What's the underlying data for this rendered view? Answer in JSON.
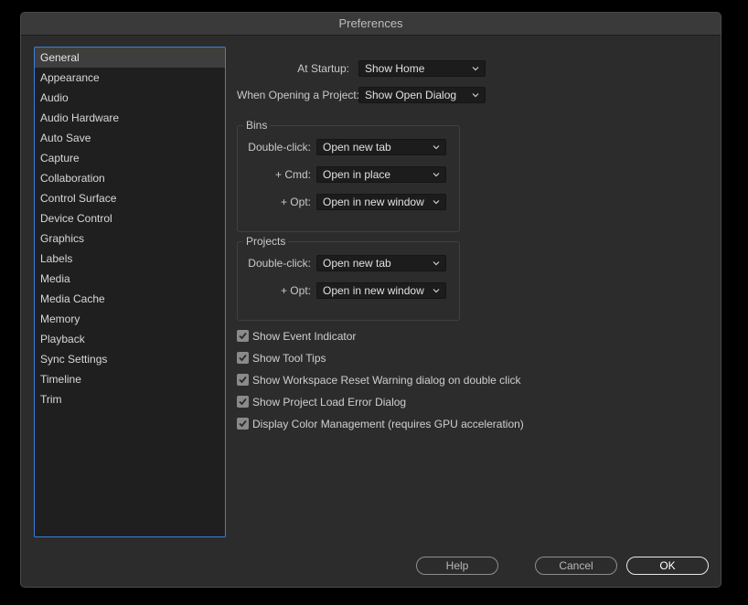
{
  "window": {
    "title": "Preferences"
  },
  "sidebar": {
    "items": [
      {
        "label": "General",
        "selected": true
      },
      {
        "label": "Appearance"
      },
      {
        "label": "Audio"
      },
      {
        "label": "Audio Hardware"
      },
      {
        "label": "Auto Save"
      },
      {
        "label": "Capture"
      },
      {
        "label": "Collaboration"
      },
      {
        "label": "Control Surface"
      },
      {
        "label": "Device Control"
      },
      {
        "label": "Graphics"
      },
      {
        "label": "Labels"
      },
      {
        "label": "Media"
      },
      {
        "label": "Media Cache"
      },
      {
        "label": "Memory"
      },
      {
        "label": "Playback"
      },
      {
        "label": "Sync Settings"
      },
      {
        "label": "Timeline"
      },
      {
        "label": "Trim"
      }
    ]
  },
  "general": {
    "at_startup": {
      "label": "At Startup:",
      "value": "Show Home"
    },
    "when_opening": {
      "label": "When Opening a Project:",
      "value": "Show Open Dialog"
    },
    "bins": {
      "title": "Bins",
      "double_click": {
        "label": "Double-click:",
        "value": "Open new tab"
      },
      "cmd": {
        "label": "+ Cmd:",
        "value": "Open in place"
      },
      "opt": {
        "label": "+ Opt:",
        "value": "Open in new window"
      }
    },
    "projects": {
      "title": "Projects",
      "double_click": {
        "label": "Double-click:",
        "value": "Open new tab"
      },
      "opt": {
        "label": "+ Opt:",
        "value": "Open in new window"
      }
    },
    "checkboxes": [
      {
        "label": "Show Event Indicator",
        "checked": true
      },
      {
        "label": "Show Tool Tips",
        "checked": true
      },
      {
        "label": "Show Workspace Reset Warning dialog on double click",
        "checked": true
      },
      {
        "label": "Show Project Load Error Dialog",
        "checked": true
      },
      {
        "label": "Display Color Management (requires GPU acceleration)",
        "checked": true
      }
    ]
  },
  "footer": {
    "help_label": "Help",
    "cancel_label": "Cancel",
    "ok_label": "OK"
  },
  "colors": {
    "accent": "#3d7ed9",
    "window_bg": "#2c2c2c",
    "sidebar_bg": "#1f1f1f"
  }
}
